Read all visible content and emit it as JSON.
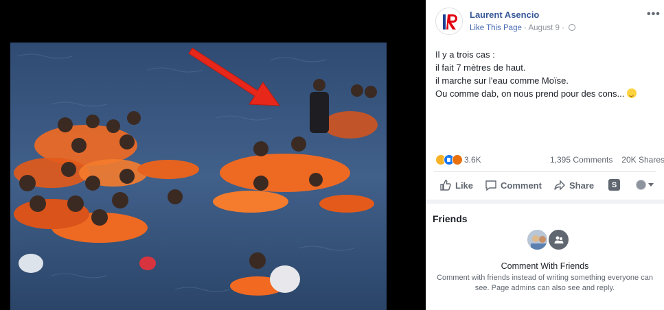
{
  "post": {
    "page_name": "Laurent Asencio",
    "like_page": "Like This Page",
    "separator": "·",
    "date": "August 9",
    "separator2": "·",
    "more_label": "•••",
    "text_lines": [
      "Il y a trois cas :",
      "il fait 7 mètres de haut.",
      "il marche sur l'eau comme Moïse.",
      "Ou comme dab, on nous prend pour des cons..."
    ],
    "avatar_logo": "IR"
  },
  "reactions": {
    "types": [
      "haha",
      "like",
      "angry"
    ],
    "count": "3.6K",
    "comments": "1,395 Comments",
    "shares": "20K Shares"
  },
  "actions": {
    "like": "Like",
    "comment": "Comment",
    "share": "Share",
    "s_button": "S"
  },
  "friends": {
    "title": "Friends",
    "cta_title": "Comment With Friends",
    "cta_desc": "Comment with friends instead of writing something everyone can see. Page admins can also see and reply."
  },
  "colors": {
    "link": "#365899",
    "like_blue": "#1877f2",
    "arrow_red": "#e8271b",
    "life_vest": "#f26a21",
    "sea": "#3f5c86"
  }
}
